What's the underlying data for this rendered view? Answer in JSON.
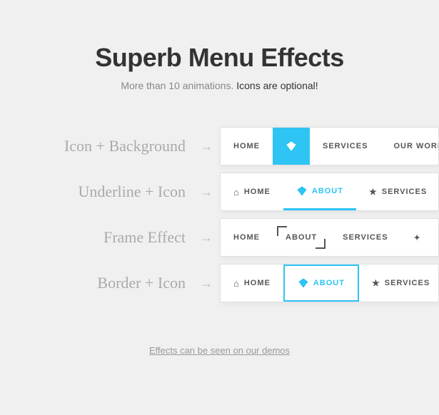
{
  "page": {
    "title": "Superb Menu Effects",
    "subtitle_text": "More than 10 animations. ",
    "subtitle_emphasis": "Icons are optional!",
    "footer_link": "Effects can be seen on our demos"
  },
  "effects": [
    {
      "label": "Icon + Background",
      "type": "icon-background",
      "nav_items": [
        {
          "text": "HOME",
          "icon": null,
          "active": false
        },
        {
          "text": "",
          "icon": "diamond",
          "active": true
        },
        {
          "text": "SERVICES",
          "icon": null,
          "active": false
        },
        {
          "text": "OUR WORK",
          "icon": null,
          "active": false
        }
      ]
    },
    {
      "label": "Underline + Icon",
      "type": "underline-icon",
      "nav_items": [
        {
          "text": "HOME",
          "icon": "home",
          "active": false
        },
        {
          "text": "ABOUT",
          "icon": "diamond",
          "active": true
        },
        {
          "text": "SERVICES",
          "icon": "star",
          "active": false
        }
      ]
    },
    {
      "label": "Frame Effect",
      "type": "frame",
      "nav_items": [
        {
          "text": "HOME",
          "icon": null,
          "active": false
        },
        {
          "text": "ABOUT",
          "icon": null,
          "active": true
        },
        {
          "text": "SERVICES",
          "icon": null,
          "active": false
        }
      ]
    },
    {
      "label": "Border + Icon",
      "type": "border-icon",
      "nav_items": [
        {
          "text": "HOME",
          "icon": "home",
          "active": false
        },
        {
          "text": "ABOUT",
          "icon": "diamond",
          "active": true
        },
        {
          "text": "SERVICES",
          "icon": "star",
          "active": false
        }
      ]
    }
  ],
  "colors": {
    "accent": "#2ec4f3",
    "text_dark": "#333",
    "text_mid": "#888",
    "text_light": "#aaa",
    "nav_bg": "#ffffff",
    "page_bg": "#f0f0f0"
  }
}
